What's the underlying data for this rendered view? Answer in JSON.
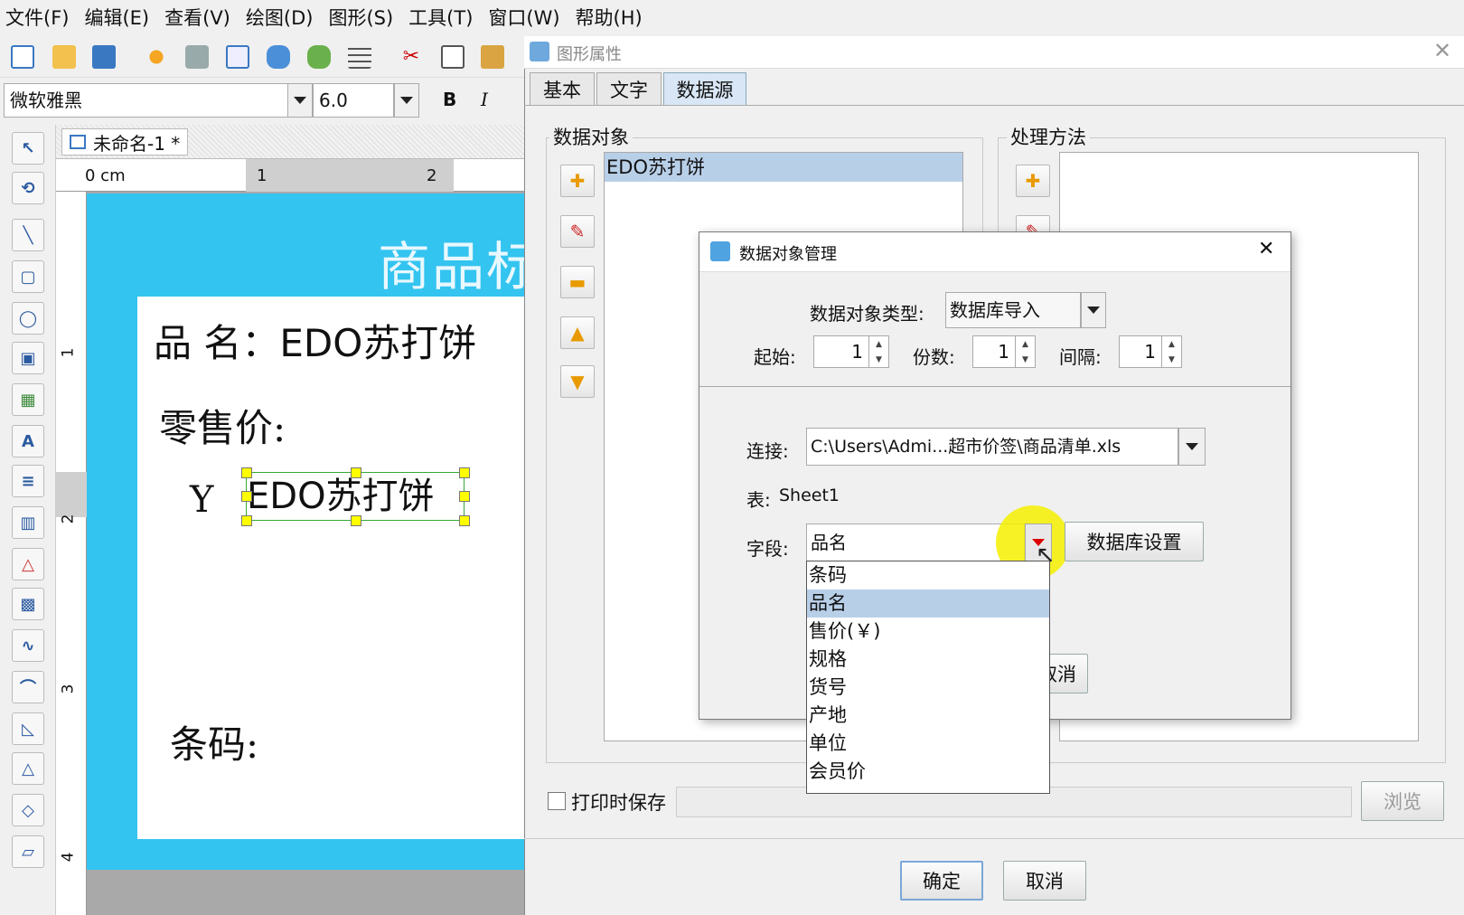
{
  "menubar": {
    "items": [
      "文件(F)",
      "编辑(E)",
      "查看(V)",
      "绘图(D)",
      "图形(S)",
      "工具(T)",
      "窗口(W)",
      "帮助(H)"
    ]
  },
  "fontbar": {
    "font_name": "微软雅黑",
    "font_size": "6.0",
    "bold": "B",
    "italic": "I"
  },
  "document": {
    "tab_title": "未命名-1 *",
    "ruler_unit": "0 cm",
    "ruler_h_marks": [
      "1",
      "2"
    ],
    "ruler_v_marks": [
      "1",
      "2",
      "3",
      "4"
    ]
  },
  "label": {
    "header": "商品标",
    "name_line": "品 名：EDO苏打饼",
    "price_label": "零售价:",
    "currency": "Y",
    "selected_text": "EDO苏打饼",
    "barcode_label": "条码:"
  },
  "properties_dialog": {
    "title": "图形属性",
    "tabs": [
      "基本",
      "文字",
      "数据源"
    ],
    "active_tab": "数据源",
    "data_object_label": "数据对象",
    "data_object_item": "EDO苏打饼",
    "method_label": "处理方法",
    "print_save_label": "打印时保存",
    "browse_label": "浏览",
    "ok_label": "确定",
    "cancel_label": "取消"
  },
  "data_object_dialog": {
    "title": "数据对象管理",
    "type_label": "数据对象类型:",
    "type_value": "数据库导入",
    "start_label": "起始:",
    "start_value": "1",
    "copies_label": "份数:",
    "copies_value": "1",
    "interval_label": "间隔:",
    "interval_value": "1",
    "connection_label": "连接:",
    "connection_value": "C:\\Users\\Admi...超市价签\\商品清单.xls",
    "table_label": "表:",
    "table_value": "Sheet1",
    "field_label": "字段:",
    "field_value": "品名",
    "db_settings_label": "数据库设置",
    "cancel_label": "取消",
    "field_options": [
      "条码",
      "品名",
      "售价(￥)",
      "规格",
      "货号",
      "产地",
      "单位",
      "会员价"
    ],
    "selected_option": "品名"
  },
  "colors": {
    "label_background": "#33c4f0",
    "selection_highlight": "#b8cfe8",
    "cursor_highlight": "#f5f000"
  }
}
